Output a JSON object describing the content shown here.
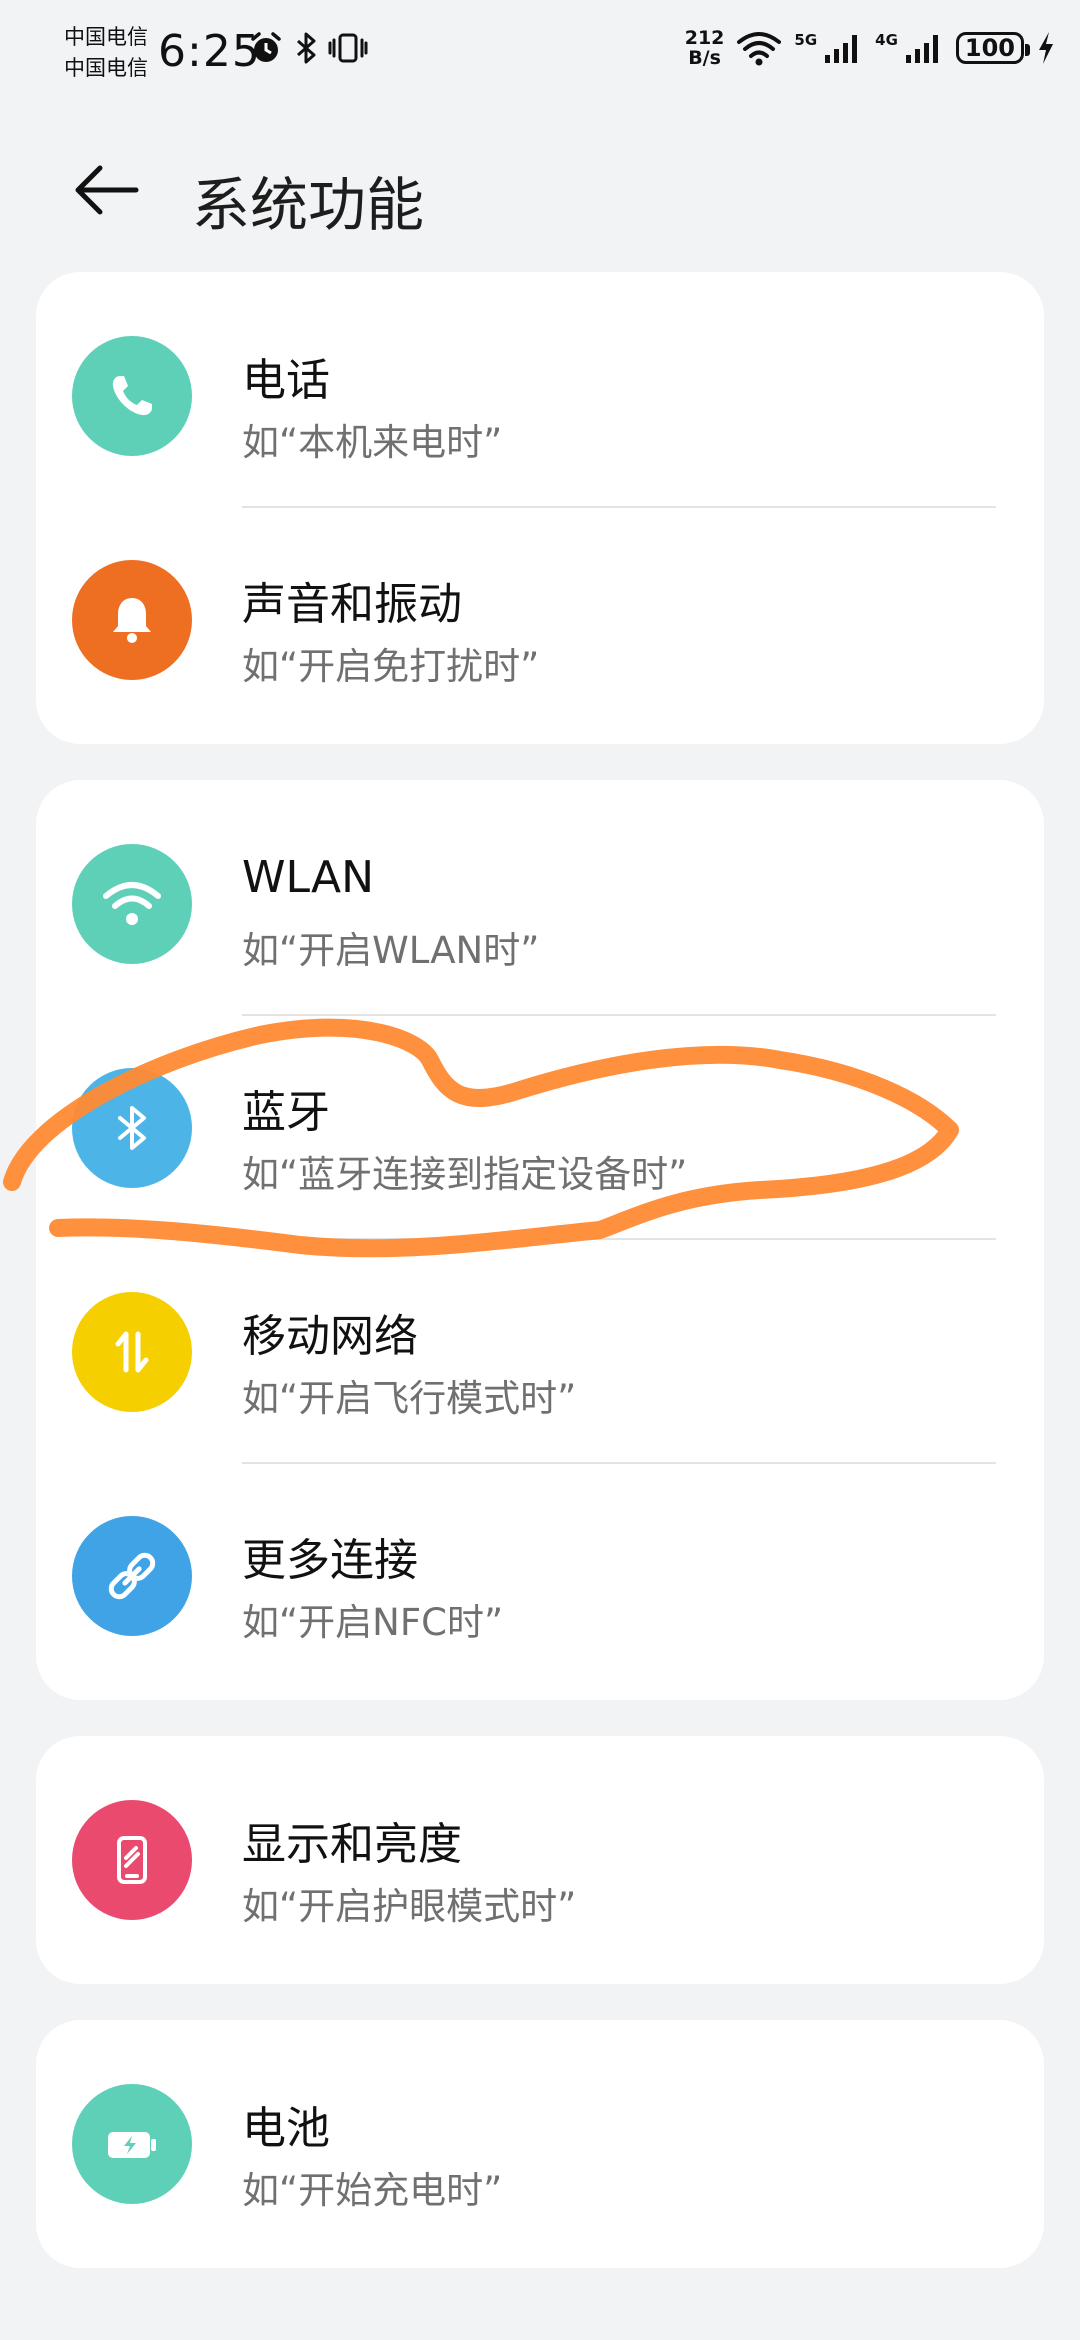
{
  "status_bar": {
    "carrier1": "中国电信",
    "carrier2": "中国电信",
    "time": "6:25",
    "net_speed_value": "212",
    "net_speed_unit": "B/s",
    "sig1_label": "5G",
    "sig2_label": "4G",
    "battery": "100"
  },
  "header": {
    "title": "系统功能"
  },
  "groups": [
    {
      "items": [
        {
          "title": "电话",
          "subtitle": "如“本机来电时”",
          "icon": "phone-icon",
          "color": "#5fd0b8"
        },
        {
          "title": "声音和振动",
          "subtitle": "如“开启免打扰时”",
          "icon": "bell-icon",
          "color": "#ee6f22"
        }
      ]
    },
    {
      "items": [
        {
          "title": "WLAN",
          "subtitle": "如“开启WLAN时”",
          "icon": "wifi-icon",
          "color": "#5fd0b8"
        },
        {
          "title": "蓝牙",
          "subtitle": "如“蓝牙连接到指定设备时”",
          "icon": "bluetooth-icon",
          "color": "#4db4e8"
        },
        {
          "title": "移动网络",
          "subtitle": "如“开启飞行模式时”",
          "icon": "mobile-data-icon",
          "color": "#f5cf00"
        },
        {
          "title": "更多连接",
          "subtitle": "如“开启NFC时”",
          "icon": "link-icon",
          "color": "#3fa3e6"
        }
      ]
    },
    {
      "items": [
        {
          "title": "显示和亮度",
          "subtitle": "如“开启护眼模式时”",
          "icon": "display-icon",
          "color": "#ea4a6e"
        }
      ]
    },
    {
      "items": [
        {
          "title": "电池",
          "subtitle": "如“开始充电时”",
          "icon": "battery-charging-icon",
          "color": "#5fd0b8"
        }
      ]
    }
  ],
  "annotation": {
    "stroke_color": "#ff8a33"
  }
}
